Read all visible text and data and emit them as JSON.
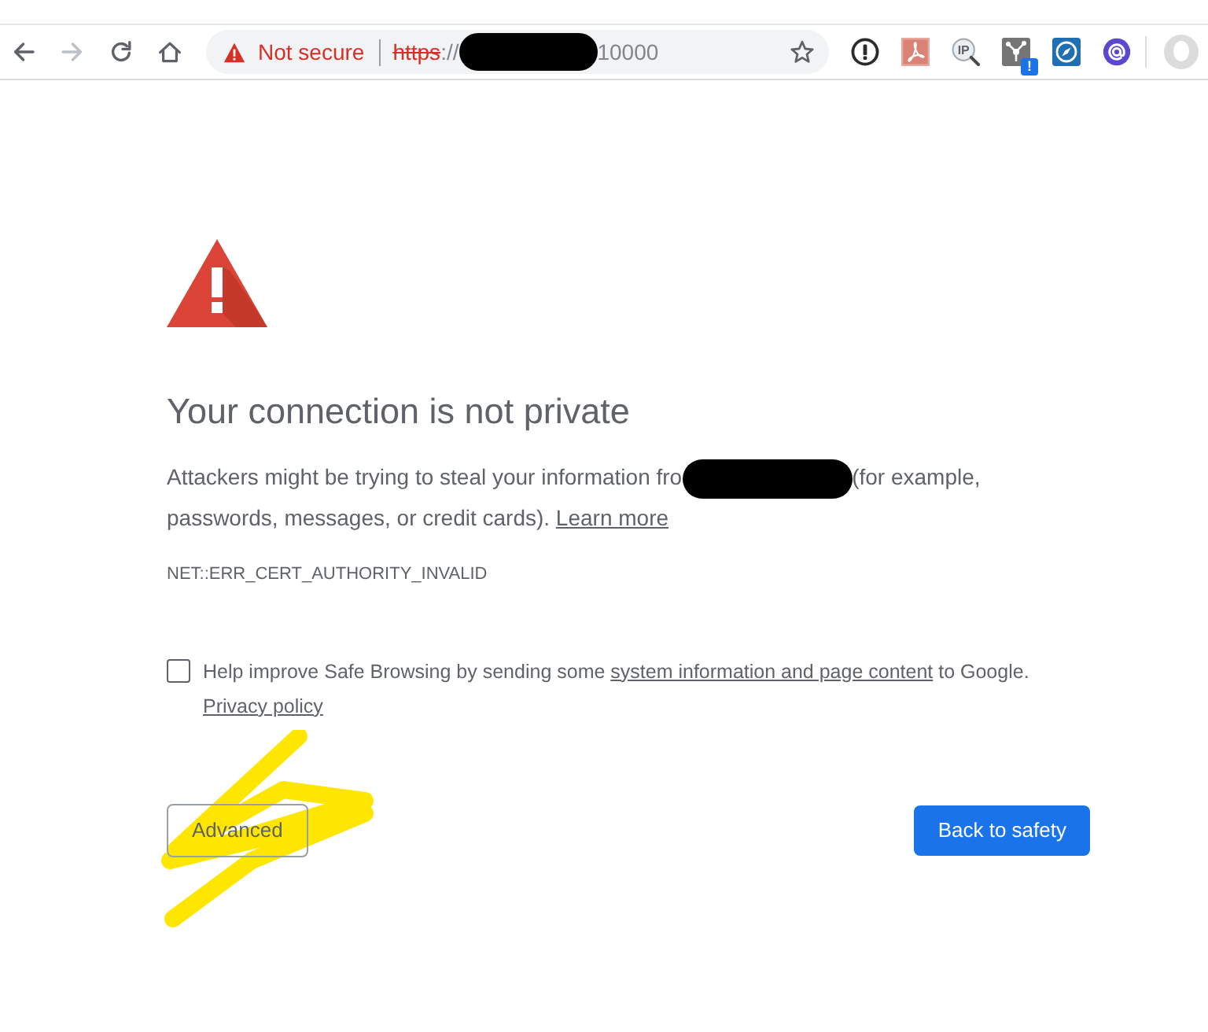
{
  "toolbar": {
    "nav_buttons": [
      {
        "kind": "back",
        "disabled": false
      },
      {
        "kind": "forward",
        "disabled": true
      },
      {
        "kind": "reload",
        "disabled": false
      },
      {
        "kind": "home",
        "disabled": false
      }
    ],
    "address_bar": {
      "security_label": "Not secure",
      "url_parts": [
        {
          "kind": "scheme",
          "text": "https"
        },
        {
          "kind": "text",
          "text": "://"
        },
        {
          "kind": "redaction"
        },
        {
          "kind": "text",
          "text": "10000"
        }
      ]
    },
    "extensions": [
      {
        "kind": "keyhole"
      },
      {
        "kind": "pdf"
      },
      {
        "kind": "ip",
        "label": "IP"
      },
      {
        "kind": "network",
        "badge": "!"
      },
      {
        "kind": "compass"
      },
      {
        "kind": "at"
      }
    ]
  },
  "interstitial": {
    "heading": "Your connection is not private",
    "message_parts": [
      {
        "kind": "text",
        "text": "Attackers might be trying to steal your information fro"
      },
      {
        "kind": "redaction"
      },
      {
        "kind": "text",
        "text": "(for example, passwords, messages, or credit cards). "
      },
      {
        "kind": "link",
        "text": "Learn more"
      }
    ],
    "error_code": "NET::ERR_CERT_AUTHORITY_INVALID",
    "safe_browsing": {
      "checked": false,
      "label_parts": [
        {
          "kind": "text",
          "text": "Help improve Safe Browsing by sending some "
        },
        {
          "kind": "link",
          "text": "system information and page content"
        },
        {
          "kind": "text",
          "text": " to Google."
        }
      ],
      "privacy_link": "Privacy policy"
    },
    "buttons": [
      {
        "kind": "secondary",
        "label": "Advanced"
      },
      {
        "kind": "primary",
        "label": "Back to safety"
      }
    ]
  }
}
